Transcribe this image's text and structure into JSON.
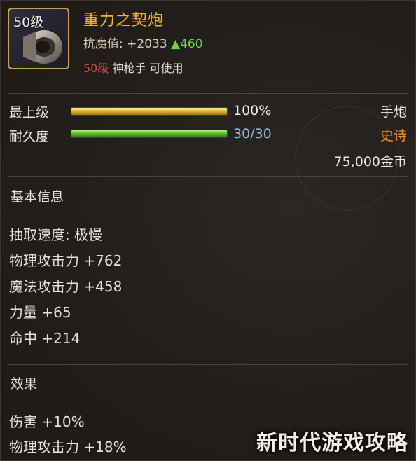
{
  "item": {
    "level_badge": "50级",
    "name": "重力之契炮",
    "resist_label": "抗魔值: +2033",
    "resist_bonus": "▲460",
    "req_level": "50级",
    "req_text": "神枪手 可使用"
  },
  "bars": {
    "level": {
      "label": "最上级",
      "value": "100%",
      "fill": 1.0
    },
    "durability": {
      "label": "耐久度",
      "value": "30/30",
      "fill": 1.0
    }
  },
  "right": {
    "type": "手炮",
    "rarity": "史诗",
    "price": "75,000金币"
  },
  "colors": {
    "name": "#f4b430",
    "rarity": "#f08a26",
    "bonus": "#6fd24a",
    "req": "#e6463e"
  },
  "basic_info": {
    "title": "基本信息",
    "lines": [
      "抽取速度: 极慢",
      "物理攻击力 +762",
      "魔法攻击力 +458",
      "力量 +65",
      "命中 +214"
    ]
  },
  "effects": {
    "title": "效果",
    "lines": [
      "伤害 +10%",
      "物理攻击力 +18%"
    ]
  },
  "watermark": "新时代游戏攻略"
}
